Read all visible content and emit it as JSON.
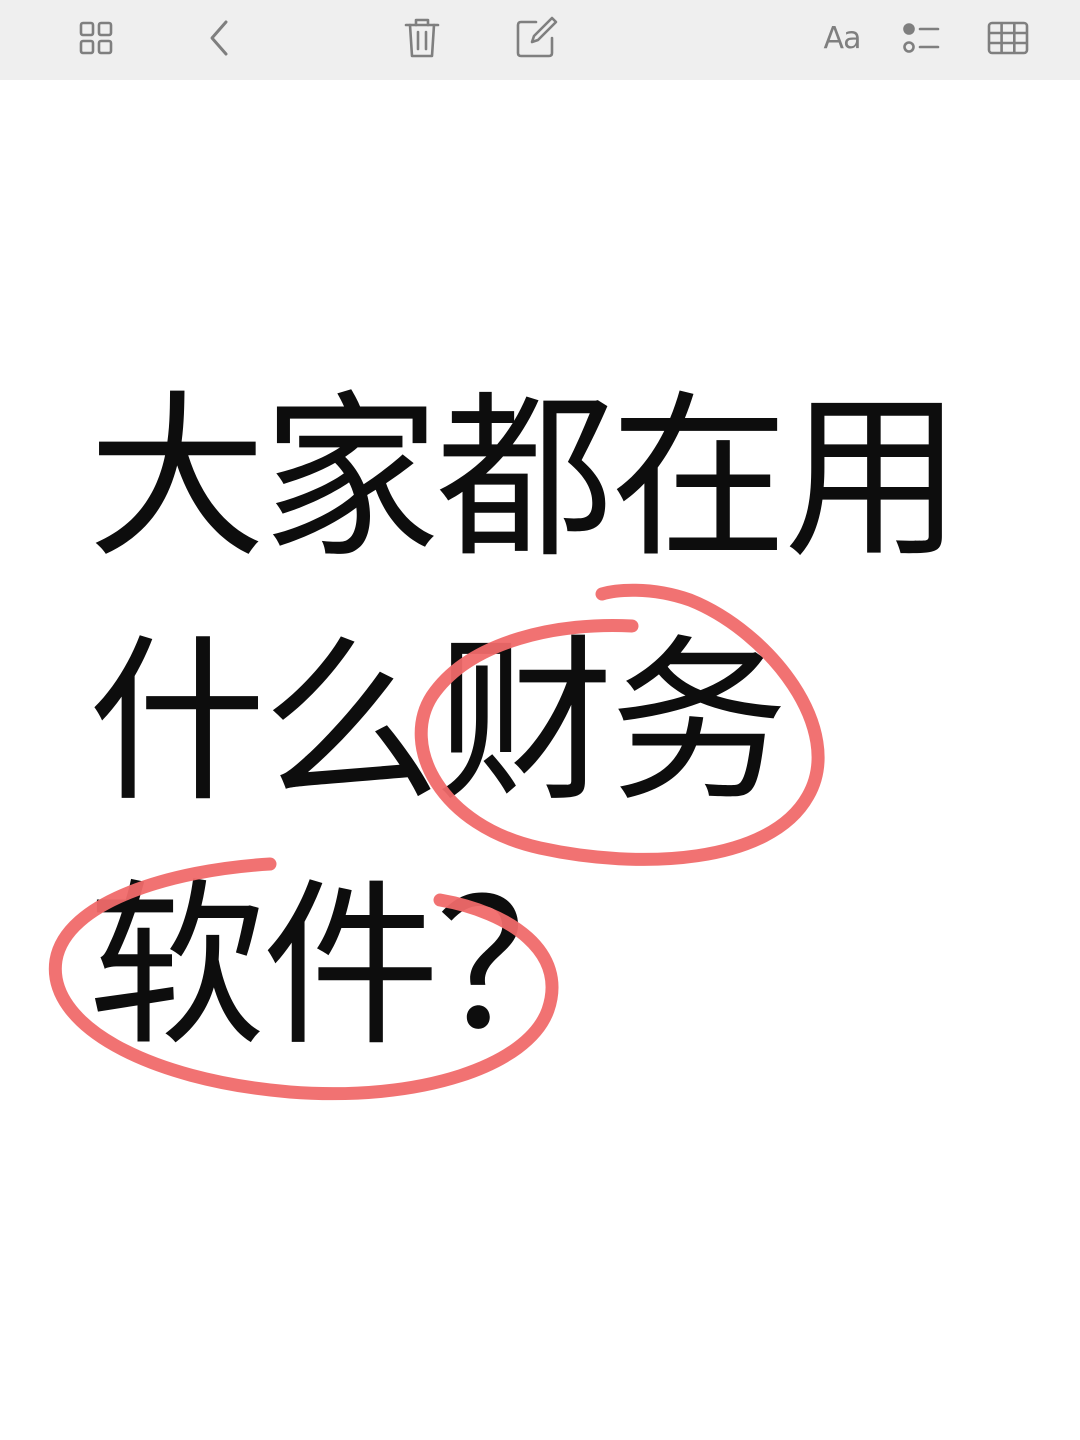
{
  "toolbar": {
    "icons": [
      "grid-icon",
      "back-chevron-icon",
      "trash-icon",
      "compose-icon",
      "text-format-icon",
      "checklist-icon",
      "table-icon"
    ],
    "format_label": "Aa"
  },
  "note": {
    "lines": [
      "大家都在用",
      "什么财务",
      "软件？"
    ]
  },
  "colors": {
    "toolbar_bg": "#efefef",
    "icon": "#7f7f7f",
    "text": "#0d0d0d",
    "highlight": "#f06a6a"
  }
}
